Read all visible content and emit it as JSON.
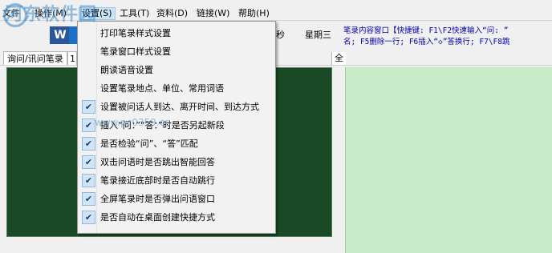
{
  "menubar": {
    "items": [
      "文件",
      "操作(M)",
      "设置(S)",
      "工具(T)",
      "资料(D)",
      "链接(W)",
      "帮助(H)"
    ]
  },
  "toolbar": {
    "w_icon_letter": "W",
    "clock_seconds": "秒",
    "weekday": "星期三"
  },
  "shortcut_panel": {
    "line1": "笔录内容窗口【快捷键: F1\\F2快速输入“问: ”",
    "line2": "名; F5删除一行; F6插入“◇”答换行; F7\\F8跳"
  },
  "tabs": {
    "left": "询问/讯问笔录",
    "left_truncated": "1",
    "right": "全"
  },
  "dropdown": {
    "items": [
      {
        "label": "打印笔录样式设置",
        "checked": false
      },
      {
        "label": "笔录窗口样式设置",
        "checked": false
      },
      {
        "label": "朗读语音设置",
        "checked": false
      },
      {
        "label": "设置笔录地点、单位、常用词语",
        "checked": false
      },
      {
        "label": "设置被问话人到达、离开时间、到达方式",
        "checked": true
      },
      {
        "label": "插入“问：”“答：”时是否另起新段",
        "checked": true
      },
      {
        "label": "是否检验“问”、“答”匹配",
        "checked": true
      },
      {
        "label": "双击问语时是否跳出智能回答",
        "checked": true
      },
      {
        "label": "笔录接近底部时是否自动跳行",
        "checked": true
      },
      {
        "label": "全屏笔录时是否弹出问语窗口",
        "checked": true
      },
      {
        "label": "是否自动在桌面创建快捷方式",
        "checked": true
      }
    ],
    "check_glyph": "✔"
  },
  "watermark": {
    "text": "河东软件园",
    "url": "www.pc0359.cn"
  },
  "colors": {
    "note_pane": "#1a4a25",
    "right_pane": "#c8ebc8",
    "check_bg": "#cfe4f7"
  }
}
